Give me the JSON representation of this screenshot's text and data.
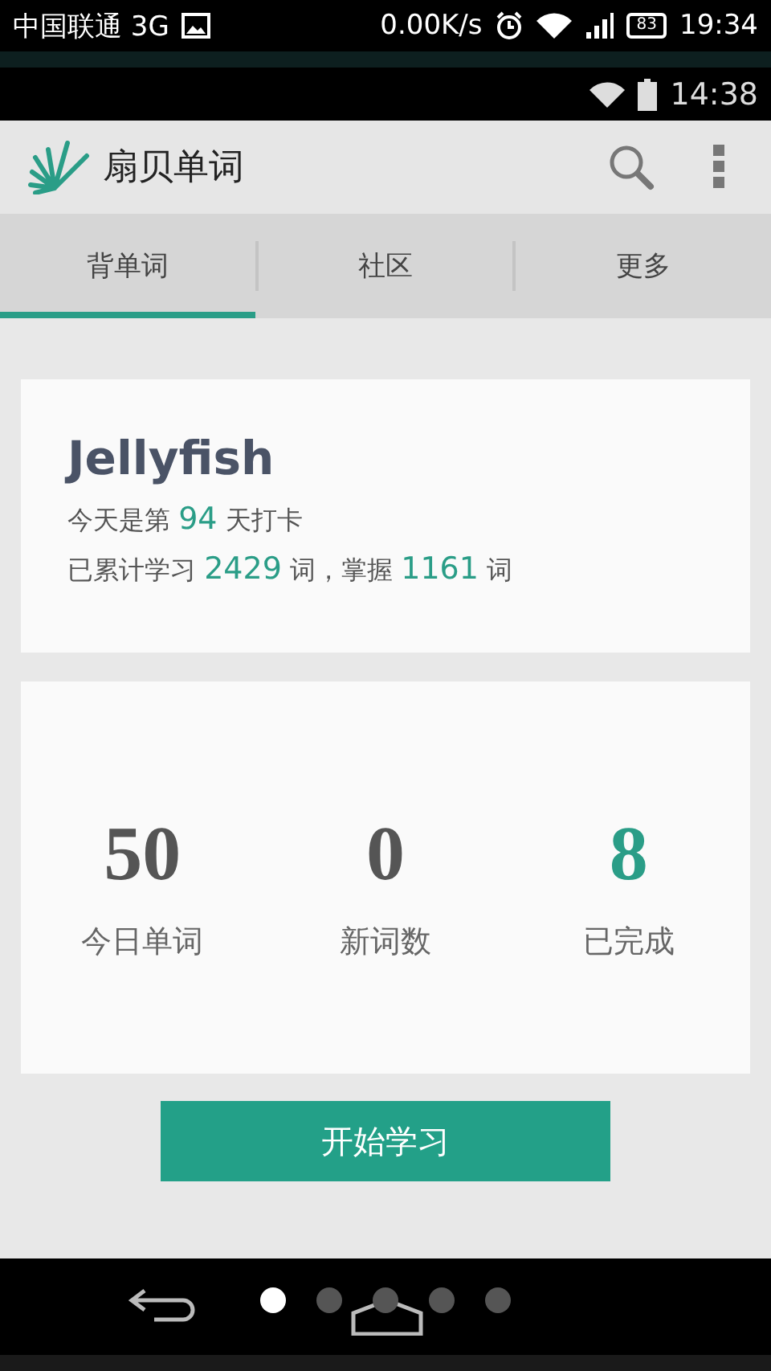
{
  "outer_status_bar": {
    "carrier": "中国联通 3G",
    "speed": "0.00K/s",
    "battery": "83",
    "time": "19:34"
  },
  "inner_status_bar": {
    "time": "14:38"
  },
  "app_bar": {
    "title": "扇贝单词"
  },
  "tabs": [
    {
      "label": "背单词",
      "selected": true
    },
    {
      "label": "社区",
      "selected": false
    },
    {
      "label": "更多",
      "selected": false
    }
  ],
  "profile_card": {
    "name": "Jellyfish",
    "checkin": [
      "今天是第 ",
      "94",
      " 天打卡"
    ],
    "progress": [
      "已累计学习 ",
      "2429",
      " 词，掌握 ",
      "1161",
      " 词"
    ]
  },
  "stats": [
    {
      "value": "50",
      "label": "今日单词",
      "highlight": false
    },
    {
      "value": "0",
      "label": "新词数",
      "highlight": false
    },
    {
      "value": "8",
      "label": "已完成",
      "highlight": true
    }
  ],
  "start_button": "开始学习",
  "page_dots": [
    {
      "selected": true
    },
    {
      "selected": false
    },
    {
      "selected": false
    },
    {
      "selected": false
    },
    {
      "selected": false
    }
  ]
}
